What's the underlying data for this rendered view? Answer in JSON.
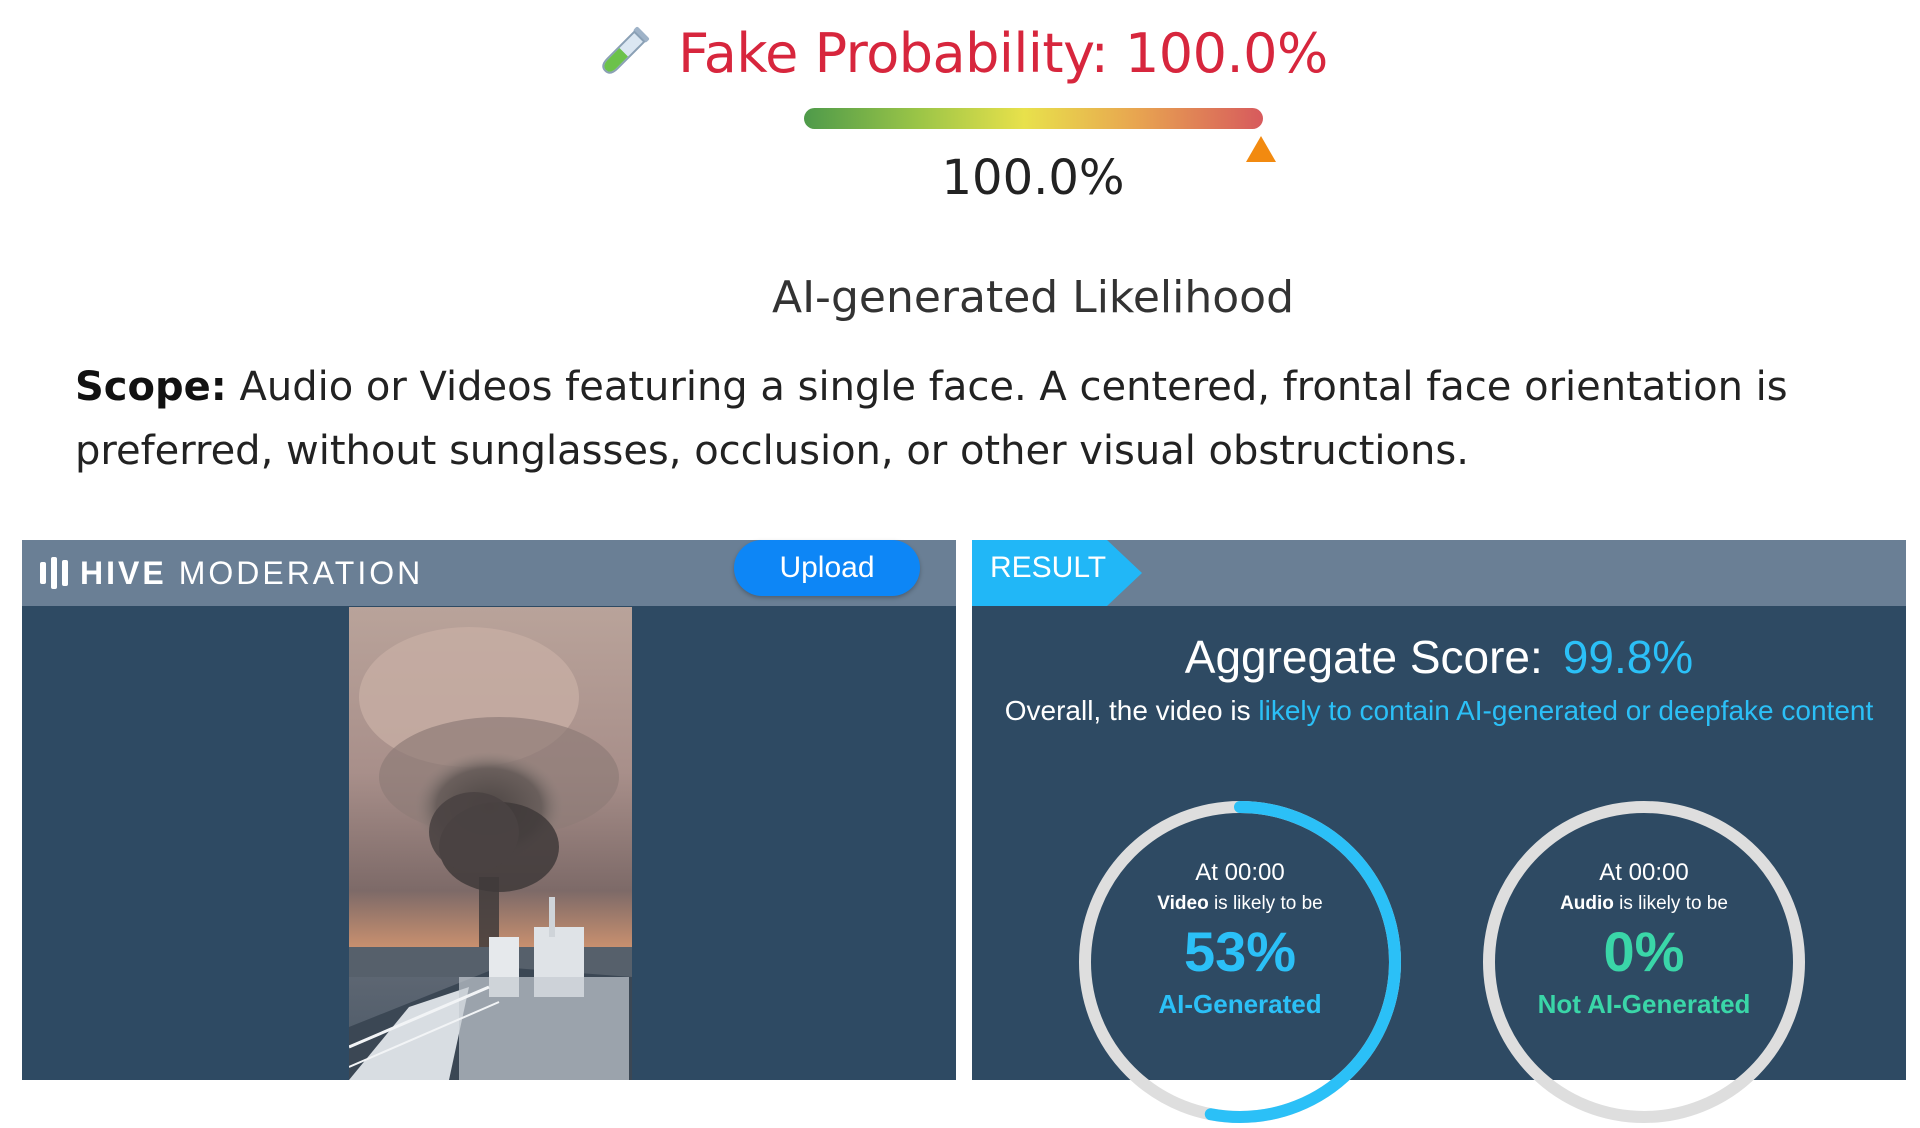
{
  "top": {
    "title": "Fake Probability: 100.0%",
    "gauge_value": "100.0%",
    "gauge_fraction": 1.0,
    "likelihood_label": "AI-generated Likelihood",
    "scope_label": "Scope:",
    "scope_text": " Audio or Videos featuring a single face. A centered, frontal face orientation is preferred, without sunglasses, occlusion, or other visual obstructions.",
    "title_icon": "test-tube-icon",
    "colors": {
      "title": "#d7263d",
      "marker": "#f28a10"
    }
  },
  "hive": {
    "brand_hive": "HIVE",
    "brand_moderation": "MODERATION",
    "upload_label": "Upload",
    "result_tab": "RESULT",
    "aggregate_label": "Aggregate Score:",
    "aggregate_value": "99.8%",
    "overall_prefix": "Overall, the video is ",
    "overall_verdict": "likely to contain AI-generated or deepfake content",
    "colors": {
      "panel": "#2e4a63",
      "header": "#6a7f95",
      "accent_blue": "#2bc0f7",
      "accent_green": "#3ad6a8",
      "upload": "#0d86f6"
    },
    "video_gauge": {
      "at": "At 00:00",
      "media": "Video",
      "likely": " is likely to be",
      "percent": "53%",
      "fraction": 0.53,
      "verdict": "AI-Generated"
    },
    "audio_gauge": {
      "at": "At 00:00",
      "media": "Audio",
      "likely": " is likely to be",
      "percent": "0%",
      "fraction": 0.0,
      "verdict": "Not AI-Generated"
    }
  }
}
